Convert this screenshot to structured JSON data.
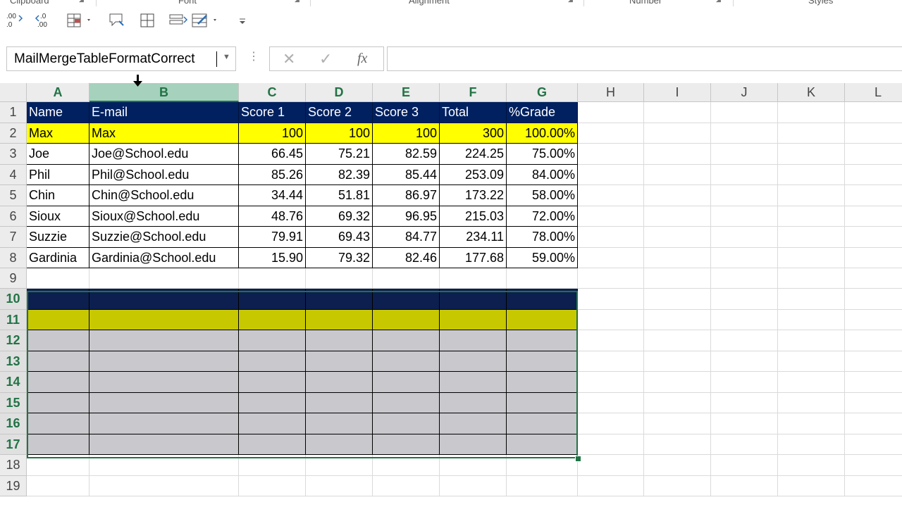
{
  "ribbon": {
    "groups": [
      "Clipboard",
      "Font",
      "Alignment",
      "Number",
      "Styles"
    ],
    "icons": [
      "increase-decimal-icon",
      "decrease-decimal-icon",
      "format-cells-dropdown-icon",
      "comment-icon",
      "borders-icon",
      "wrap-merge-icon",
      "conditional-format-icon",
      "customize-toolbar-icon"
    ]
  },
  "formula_bar": {
    "name_box": "MailMergeTableFormatCorrect",
    "cancel_glyph": "✕",
    "enter_glyph": "✓",
    "fx_label": "fx",
    "formula": ""
  },
  "sheet": {
    "columns": [
      "A",
      "B",
      "C",
      "D",
      "E",
      "F",
      "G",
      "H",
      "I",
      "J",
      "K",
      "L"
    ],
    "rows": [
      "1",
      "2",
      "3",
      "4",
      "5",
      "6",
      "7",
      "8",
      "9",
      "10",
      "11",
      "12",
      "13",
      "14",
      "15",
      "16",
      "17",
      "18",
      "19"
    ],
    "selected_column": "B",
    "selected_rows": [
      "10",
      "11",
      "12",
      "13",
      "14",
      "15",
      "16",
      "17"
    ],
    "header": [
      "Name",
      "E-mail",
      "Score 1",
      "Score 2",
      "Score 3",
      "Total",
      "%Grade"
    ],
    "data": [
      [
        "Max",
        "Max",
        "100",
        "100",
        "100",
        "300",
        "100.00%"
      ],
      [
        "Joe",
        "Joe@School.edu",
        "66.45",
        "75.21",
        "82.59",
        "224.25",
        "75.00%"
      ],
      [
        "Phil",
        "Phil@School.edu",
        "85.26",
        "82.39",
        "85.44",
        "253.09",
        "84.00%"
      ],
      [
        "Chin",
        "Chin@School.edu",
        "34.44",
        "51.81",
        "86.97",
        "173.22",
        "58.00%"
      ],
      [
        "Sioux",
        "Sioux@School.edu",
        "48.76",
        "69.32",
        "96.95",
        "215.03",
        "72.00%"
      ],
      [
        "Suzzie",
        "Suzzie@School.edu",
        "79.91",
        "69.43",
        "84.77",
        "234.11",
        "78.00%"
      ],
      [
        "Gardinia",
        "Gardinia@School.edu",
        "15.90",
        "79.32",
        "82.46",
        "177.68",
        "59.00%"
      ]
    ]
  },
  "colors": {
    "header_fill": "#002060",
    "highlight_fill": "#FFFF00",
    "selection_border": "#217346"
  }
}
